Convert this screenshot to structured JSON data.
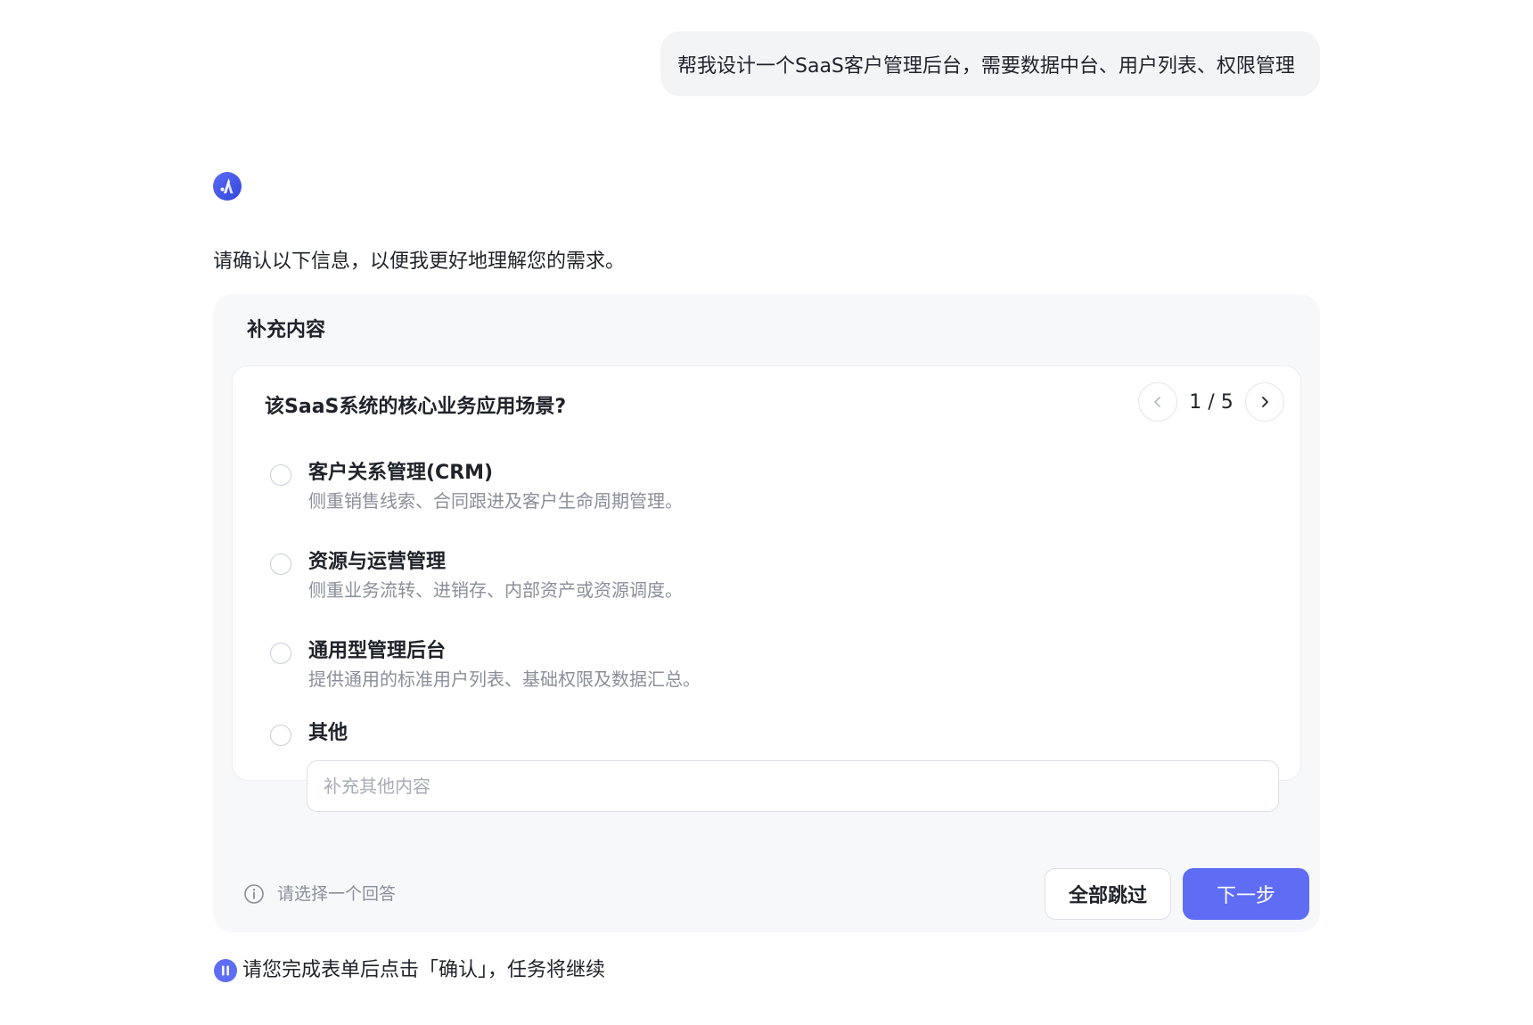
{
  "user_message": "帮我设计一个SaaS客户管理后台，需要数据中台、用户列表、权限管理",
  "assistant": {
    "avatar_icon": "assistant-logo-icon",
    "message": "请确认以下信息，以便我更好地理解您的需求。"
  },
  "form": {
    "title": "补充内容",
    "question": "该SaaS系统的核心业务应用场景?",
    "pager": {
      "current": "1 / 5"
    },
    "options": [
      {
        "label": "客户关系管理(CRM)",
        "description": "侧重销售线索、合同跟进及客户生命周期管理。"
      },
      {
        "label": "资源与运营管理",
        "description": "侧重业务流转、进销存、内部资产或资源调度。"
      },
      {
        "label": "通用型管理后台",
        "description": "提供通用的标准用户列表、基础权限及数据汇总。"
      },
      {
        "label": "其他",
        "description": ""
      }
    ],
    "other_input": {
      "placeholder": "补充其他内容",
      "value": ""
    },
    "hint": "请选择一个回答",
    "skip_label": "全部跳过",
    "next_label": "下一步"
  },
  "status": {
    "text": "请您完成表单后点击「确认」，任务将继续",
    "icon": "pause-icon"
  },
  "colors": {
    "accent": "#5f6df5",
    "bubble_bg": "#f3f4f6",
    "panel_bg": "#f7f8fa",
    "muted_text": "#8a8f99"
  }
}
